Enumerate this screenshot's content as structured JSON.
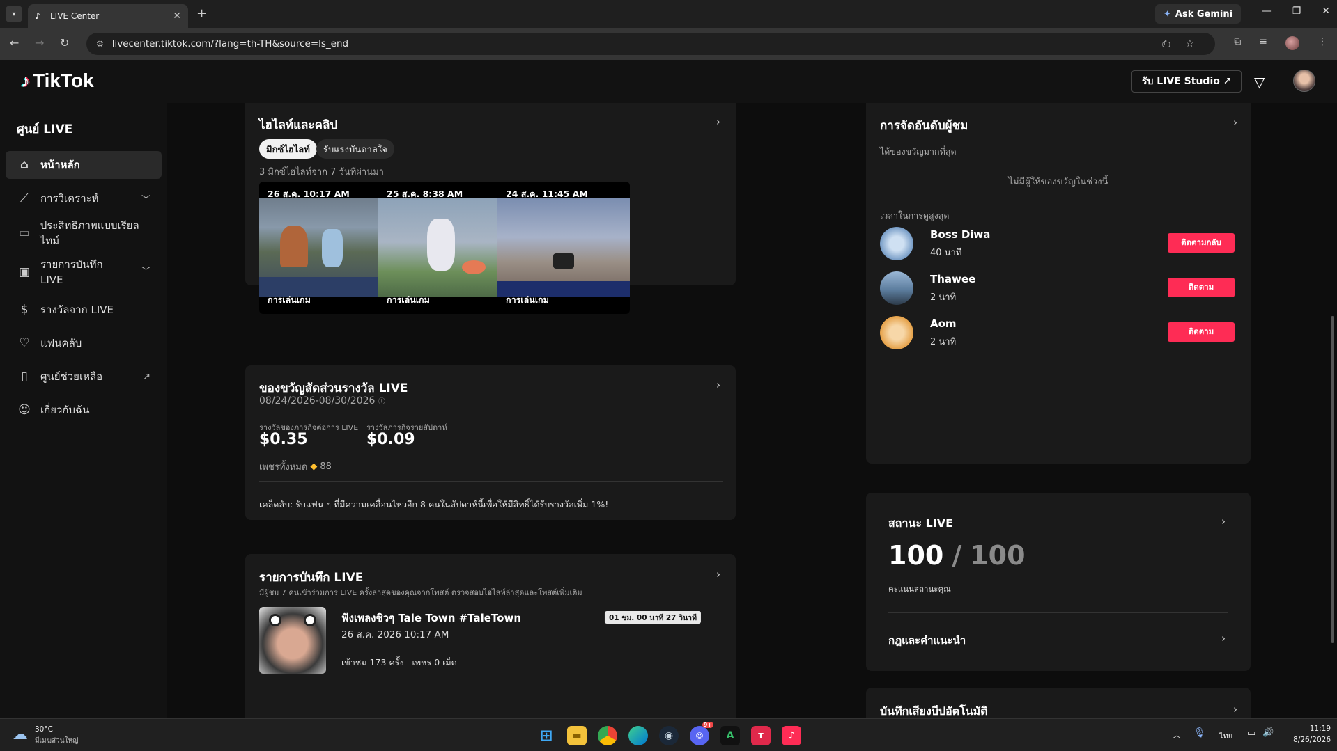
{
  "browser": {
    "tab_title": "LIVE Center",
    "new_tab": "+",
    "ask_gemini": "Ask Gemini",
    "url": "livecenter.tiktok.com/?lang=th-TH&source=ls_end"
  },
  "header": {
    "logo_text": "TikTok",
    "studio_button": "รับ LIVE Studio ↗"
  },
  "sidebar": {
    "title": "ศูนย์ LIVE",
    "items": [
      {
        "label": "หน้าหลัก",
        "icon": "home-icon"
      },
      {
        "label": "การวิเคราะห์",
        "icon": "chart-icon"
      },
      {
        "label": "ประสิทธิภาพแบบเรียลไทม์",
        "icon": "realtime-icon"
      },
      {
        "label": "รายการบันทึก LIVE",
        "icon": "record-icon"
      },
      {
        "label": "รางวัลจาก LIVE",
        "icon": "reward-icon"
      },
      {
        "label": "แฟนคลับ",
        "icon": "fanclub-icon"
      },
      {
        "label": "ศูนย์ช่วยเหลือ",
        "icon": "help-icon"
      },
      {
        "label": "เกี่ยวกับฉัน",
        "icon": "user-icon"
      }
    ]
  },
  "highlights": {
    "title": "ไฮไลท์และคลิป",
    "chip_selected": "มิกซ์ไฮไลท์",
    "chip_other": "รับแรงบันดาลใจ",
    "subtitle": "3 มิกซ์ไฮไลท์จาก 7 วันที่ผ่านมา",
    "clips": [
      {
        "date": "26 ส.ค. 10:17 AM",
        "category": "การเล่นเกม"
      },
      {
        "date": "25 ส.ค. 8:38 AM",
        "category": "การเล่นเกม"
      },
      {
        "date": "24 ส.ค. 11:45 AM",
        "category": "การเล่นเกม"
      }
    ]
  },
  "rewards": {
    "title": "ของขวัญสัดส่วนรางวัล LIVE",
    "date_range": "08/24/2026-08/30/2026",
    "info_icon": "ⓘ",
    "stat1_label": "รางวัลของภารกิจต่อการ LIVE",
    "stat1_value": "$0.35",
    "stat2_label": "รางวัลภารกิจรายสัปดาห์",
    "stat2_value": "$0.09",
    "diamonds_label": "เพชรทั้งหมด",
    "diamonds_value": "88",
    "tip": "เคล็ดลับ: รับแฟน ๆ ที่มีความเคลื่อนไหวอีก 8 คนในสัปดาห์นี้เพื่อให้มีสิทธิ์ได้รับรางวัลเพิ่ม 1%!"
  },
  "live_records": {
    "title": "รายการบันทึก LIVE",
    "subtitle": "มีผู้ชม 7 คนเข้าร่วมการ LIVE ครั้งล่าสุดของคุณจากโพสต์ ตรวจสอบไฮไลท์ล่าสุดและโพสต์เพิ่มเติม",
    "item": {
      "title": "ฟังเพลงชิวๆ Tale Town #TaleTown",
      "date": "26 ส.ค. 2026 10:17 AM",
      "duration": "01 ชม. 00 นาที 27 วินาที",
      "views": "เข้าชม 173 ครั้ง",
      "diamonds": "เพชร 0 เม็ด"
    }
  },
  "viewer_ranking": {
    "title": "การจัดอันดับผู้ชม",
    "gift_section": "ได้ของขวัญมากที่สุด",
    "no_gift": "ไม่มีผู้ให้ของขวัญในช่วงนี้",
    "watch_section": "เวลาในการดูสูงสุด",
    "viewers": [
      {
        "name": "Boss Diwa",
        "time": "40 นาที",
        "button": "ติดตามกลับ",
        "avatar_color": "#8fb3d9"
      },
      {
        "name": "Thawee",
        "time": "2 นาที",
        "button": "ติดตาม",
        "avatar_color": "#4a6a8a"
      },
      {
        "name": "Aom",
        "time": "2 นาที",
        "button": "ติดตาม",
        "avatar_color": "#e8a040"
      }
    ]
  },
  "live_status": {
    "title": "สถานะ LIVE",
    "score": "100",
    "separator": "/",
    "max": "100",
    "score_label": "คะแนนสถานะคุณ",
    "rules": "กฎและคำแนะนำ"
  },
  "auto_record": {
    "title": "บันทึกเสียงบีปอัตโนมัติ"
  },
  "taskbar": {
    "temp": "30°C",
    "weather": "มีเมฆส่วนใหญ่",
    "lang": "ไทย",
    "time": "11:19",
    "date": "8/26/2026",
    "discord_badge": "9+"
  },
  "colors": {
    "accent": "#fe2c55",
    "card_bg": "#1a1a1a",
    "page_bg": "#0d0d0d"
  }
}
